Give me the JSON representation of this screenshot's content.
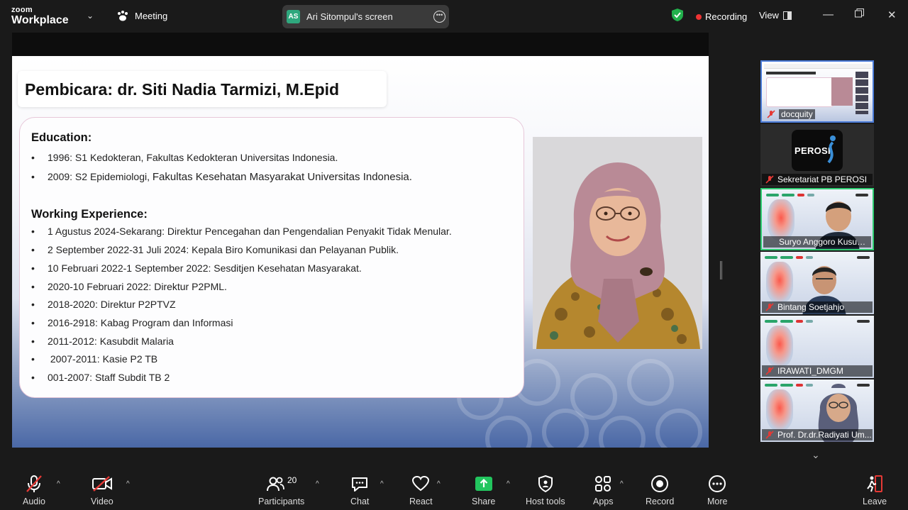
{
  "app": {
    "brand_top": "zoom",
    "brand_bottom": "Workplace",
    "meeting_label": "Meeting"
  },
  "share": {
    "avatar_initials": "AS",
    "label": "Ari Sitompul's screen"
  },
  "status": {
    "recording": "Recording",
    "view": "View"
  },
  "slide": {
    "title": "Pembicara: dr. Siti Nadia Tarmizi, M.Epid",
    "education_title": "Education:",
    "education": [
      "1996: S1 Kedokteran, Fakultas Kedokteran Universitas Indonesia.",
      "2009: S2 Epidemiologi,",
      "Fakultas Kesehatan Masyarakat Universitas Indonesia."
    ],
    "work_title": "Working Experience:",
    "work": [
      "1 Agustus 2024-Sekarang: Direktur Pencegahan dan Pengendalian Penyakit Tidak Menular.",
      "2 September 2022-31 Juli 2024: Kepala Biro Komunikasi dan Pelayanan Publik.",
      "10 Februari 2022-1 September 2022: Sesditjen Kesehatan Masyarakat.",
      "2020-10 Februari 2022: Direktur P2PML.",
      "2018-2020: Direktur P2PTVZ",
      "2016-2918: Kabag Program dan Informasi",
      "2011-2012: Kasubdit Malaria",
      " 2007-2011: Kasie P2 TB",
      "001-2007: Staff Subdit TB 2"
    ],
    "bullet": "•"
  },
  "participants_panel": [
    {
      "name": "docquity"
    },
    {
      "name": "Sekretariat PB PEROSI",
      "avatar_text": "PEROSI"
    },
    {
      "name": "Suryo Anggoro Kusumo ..."
    },
    {
      "name": "Bintang Soetjahjo"
    },
    {
      "name": "IRAWATI_DMGM"
    },
    {
      "name": "Prof. Dr.dr.Radiyati Um..."
    }
  ],
  "toolbar": {
    "audio": "Audio",
    "video": "Video",
    "participants": "Participants",
    "participants_count": "20",
    "chat": "Chat",
    "react": "React",
    "share": "Share",
    "host_tools": "Host tools",
    "apps": "Apps",
    "record": "Record",
    "more": "More",
    "leave": "Leave"
  },
  "colors": {
    "share_green": "#22c55e",
    "recording_red": "#ee3333",
    "active_border": "#2ecc71"
  }
}
